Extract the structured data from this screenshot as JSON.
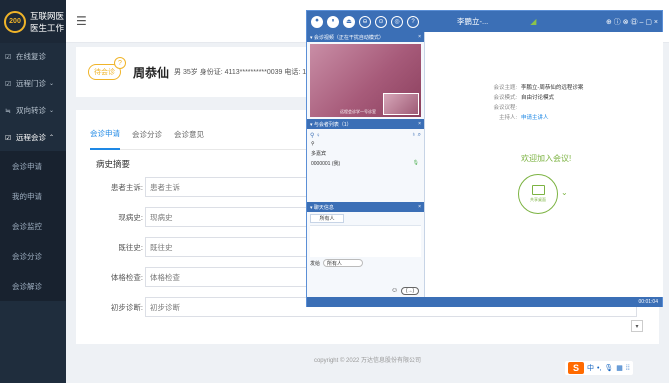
{
  "sidebar": {
    "brand_logo": "200",
    "brand_line1": "互联网医",
    "brand_line2": "医生工作",
    "items": [
      {
        "icon": "☑",
        "label": "在线复诊"
      },
      {
        "icon": "☑",
        "label": "远程门诊",
        "caret": "⌄"
      },
      {
        "icon": "≒",
        "label": "双向转诊",
        "caret": "⌄"
      },
      {
        "icon": "☑",
        "label": "远程会诊",
        "caret": "⌃"
      }
    ],
    "sub_items": [
      "会诊申请",
      "我的申请",
      "会诊监控",
      "会诊分诊",
      "会诊解诊"
    ]
  },
  "topbar": {
    "hamburger": "☰"
  },
  "patient": {
    "status": "待会诊",
    "badge": "?",
    "name": "周恭仙",
    "meta": "男  35岁   身份证: 4113**********0039   电话: 13"
  },
  "tabs": [
    "会诊申请",
    "会诊分诊",
    "会诊意见"
  ],
  "section_title": "病史摘要",
  "form": [
    {
      "label": "患者主诉:",
      "value": "患者主诉"
    },
    {
      "label": "现病史:",
      "value": "现病史"
    },
    {
      "label": "既往史:",
      "value": "既往史"
    },
    {
      "label": "体格检查:",
      "value": "体格检查"
    },
    {
      "label": "初步诊断:",
      "value": "初步诊断"
    }
  ],
  "scroll_arrow": "▾",
  "footer": "copyright © 2022 万达信息股份有限公司",
  "ime": {
    "logo": "S",
    "lang": "中",
    "punct": "•,",
    "mic": "🎙",
    "kbd": "▦",
    "grid": "⁞⁞"
  },
  "vc": {
    "top_buttons": [
      "⏺",
      "⏸",
      "⏏",
      "⊖",
      "⊙",
      "◎",
      "?"
    ],
    "caption": "李鹏立-...",
    "signal": "◢",
    "window_controls": "⊕  ⓘ  ⊗  ㊐  –  ▢  ×",
    "video_head": "▾ 会诊视频（正在干扰自动模式）",
    "video_strip": "远程会诊学一号诊室",
    "members_head": "▾ 与会者列表（1）",
    "members_tools_left": "⚲ ♀",
    "members_tools_right": "♁ ⌕",
    "member_group": "多嘉宾",
    "member_row": "0000001 (我)",
    "chat_head": "▾ 聊天信息",
    "chat_tab": "所有人",
    "send_label": "发给",
    "send_target": "所有人",
    "send_btn": "(→)",
    "smile": "☺",
    "info": [
      {
        "label": "会议主题:",
        "value": "李鹏立-周恭仙的远程诊案"
      },
      {
        "label": "会议模式:",
        "value": "自由讨论模式"
      },
      {
        "label": "会议议程:",
        "value": ""
      },
      {
        "label": "主持人:",
        "value": "申请主讲人"
      }
    ],
    "welcome": "欢迎加入会议!",
    "share_label": "共享桌面",
    "share_caret": "⌄",
    "status_time": "00:01:04"
  }
}
